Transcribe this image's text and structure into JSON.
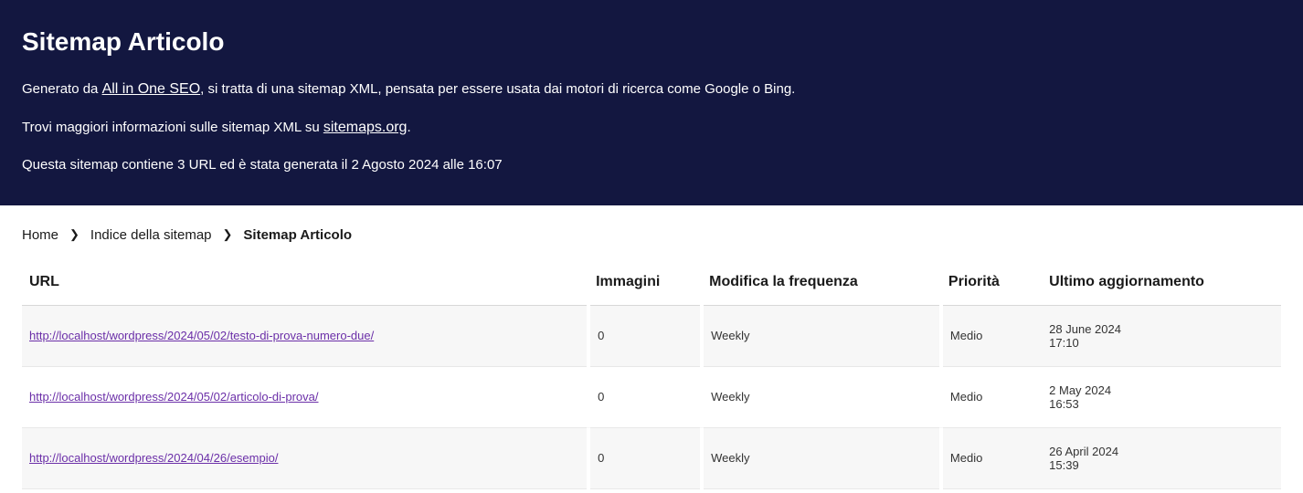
{
  "header": {
    "title": "Sitemap Articolo",
    "line1_prefix": "Generato da ",
    "line1_link": "All in One SEO",
    "line1_suffix": ", si tratta di una sitemap XML, pensata per essere usata dai motori di ricerca come Google o Bing.",
    "line2_prefix": "Trovi maggiori informazioni sulle sitemap XML su ",
    "line2_link": "sitemaps.org",
    "line2_suffix": ".",
    "line3": "Questa sitemap contiene 3 URL ed è stata generata il 2 Agosto 2024 alle 16:07"
  },
  "breadcrumb": {
    "home": "Home",
    "index": "Indice della sitemap",
    "current": "Sitemap Articolo"
  },
  "table": {
    "headers": {
      "url": "URL",
      "images": "Immagini",
      "changefreq": "Modifica la frequenza",
      "priority": "Priorità",
      "updated": "Ultimo aggiornamento"
    },
    "rows": [
      {
        "url": "http://localhost/wordpress/2024/05/02/testo-di-prova-numero-due/",
        "images": "0",
        "changefreq": "Weekly",
        "priority": "Medio",
        "updated_date": "28 June 2024",
        "updated_time": "17:10"
      },
      {
        "url": "http://localhost/wordpress/2024/05/02/articolo-di-prova/",
        "images": "0",
        "changefreq": "Weekly",
        "priority": "Medio",
        "updated_date": "2 May 2024",
        "updated_time": "16:53"
      },
      {
        "url": "http://localhost/wordpress/2024/04/26/esempio/",
        "images": "0",
        "changefreq": "Weekly",
        "priority": "Medio",
        "updated_date": "26 April 2024",
        "updated_time": "15:39"
      }
    ]
  }
}
